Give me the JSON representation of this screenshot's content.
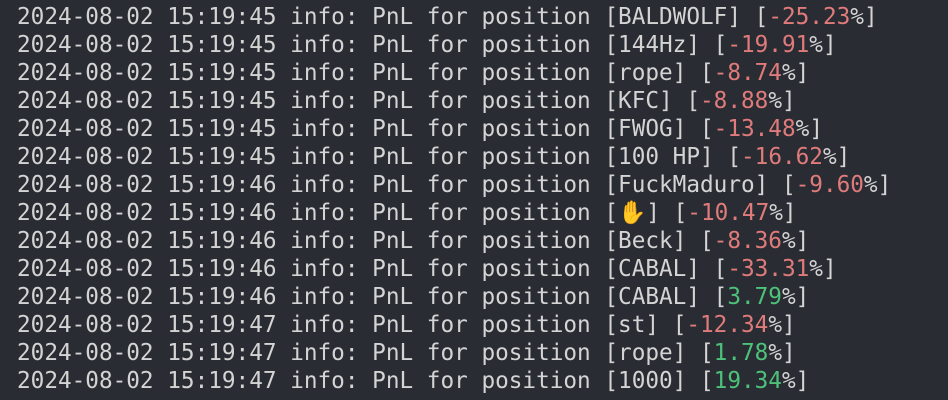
{
  "colors": {
    "background": "#2a2c33",
    "text": "#d4d4d4",
    "negative": "#e07b7b",
    "positive": "#4cc27a"
  },
  "log": [
    {
      "timestamp": "2024-08-02 15:19:45",
      "level": "info:",
      "message": "PnL for position",
      "symbol": "BALDWOLF",
      "pnl": "-25.23",
      "sign": "neg"
    },
    {
      "timestamp": "2024-08-02 15:19:45",
      "level": "info:",
      "message": "PnL for position",
      "symbol": "144Hz",
      "pnl": "-19.91",
      "sign": "neg"
    },
    {
      "timestamp": "2024-08-02 15:19:45",
      "level": "info:",
      "message": "PnL for position",
      "symbol": "rope",
      "pnl": "-8.74",
      "sign": "neg"
    },
    {
      "timestamp": "2024-08-02 15:19:45",
      "level": "info:",
      "message": "PnL for position",
      "symbol": "KFC",
      "pnl": "-8.88",
      "sign": "neg"
    },
    {
      "timestamp": "2024-08-02 15:19:45",
      "level": "info:",
      "message": "PnL for position",
      "symbol": "FWOG",
      "pnl": "-13.48",
      "sign": "neg"
    },
    {
      "timestamp": "2024-08-02 15:19:45",
      "level": "info:",
      "message": "PnL for position",
      "symbol": "100 HP",
      "pnl": "-16.62",
      "sign": "neg"
    },
    {
      "timestamp": "2024-08-02 15:19:46",
      "level": "info:",
      "message": "PnL for position",
      "symbol": "FuckMaduro",
      "pnl": "-9.60",
      "sign": "neg"
    },
    {
      "timestamp": "2024-08-02 15:19:46",
      "level": "info:",
      "message": "PnL for position",
      "symbol": "✋",
      "pnl": "-10.47",
      "sign": "neg"
    },
    {
      "timestamp": "2024-08-02 15:19:46",
      "level": "info:",
      "message": "PnL for position",
      "symbol": "Beck",
      "pnl": "-8.36",
      "sign": "neg"
    },
    {
      "timestamp": "2024-08-02 15:19:46",
      "level": "info:",
      "message": "PnL for position",
      "symbol": "CABAL",
      "pnl": "-33.31",
      "sign": "neg"
    },
    {
      "timestamp": "2024-08-02 15:19:46",
      "level": "info:",
      "message": "PnL for position",
      "symbol": "CABAL",
      "pnl": "3.79",
      "sign": "pos"
    },
    {
      "timestamp": "2024-08-02 15:19:47",
      "level": "info:",
      "message": "PnL for position",
      "symbol": "st",
      "pnl": "-12.34",
      "sign": "neg"
    },
    {
      "timestamp": "2024-08-02 15:19:47",
      "level": "info:",
      "message": "PnL for position",
      "symbol": "rope",
      "pnl": "1.78",
      "sign": "pos"
    },
    {
      "timestamp": "2024-08-02 15:19:47",
      "level": "info:",
      "message": "PnL for position",
      "symbol": "1000",
      "pnl": "19.34",
      "sign": "pos"
    }
  ],
  "percent": "%"
}
